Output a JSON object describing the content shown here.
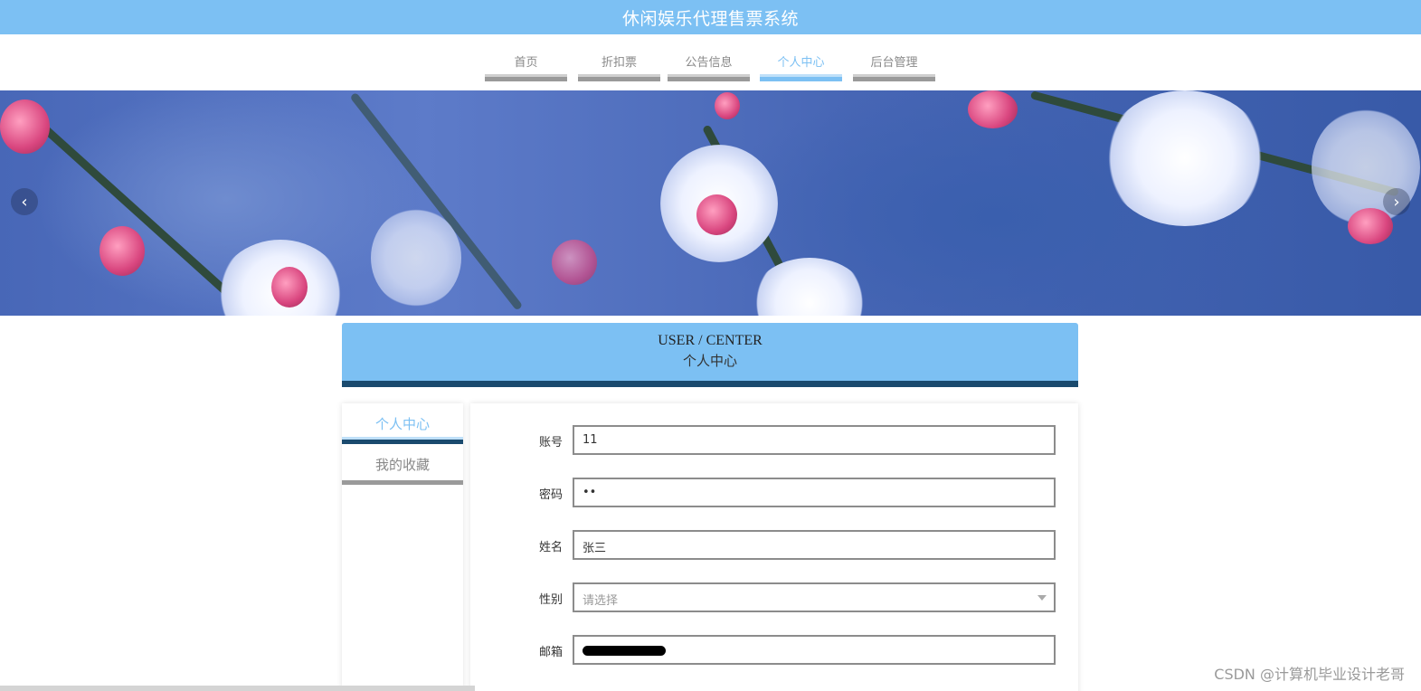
{
  "header": {
    "title": "休闲娱乐代理售票系统"
  },
  "nav": {
    "items": [
      {
        "label": "首页",
        "active": false
      },
      {
        "label": "折扣票",
        "active": false
      },
      {
        "label": "公告信息",
        "active": false
      },
      {
        "label": "个人中心",
        "active": true
      },
      {
        "label": "后台管理",
        "active": false
      }
    ]
  },
  "banner": {
    "prev_icon": "chevron-left-icon",
    "next_icon": "chevron-right-icon"
  },
  "section": {
    "title_en": "USER / CENTER",
    "title_cn": "个人中心"
  },
  "sidebar": {
    "items": [
      {
        "label": "个人中心",
        "active": true
      },
      {
        "label": "我的收藏",
        "active": false
      }
    ]
  },
  "form": {
    "account": {
      "label": "账号",
      "value": "11"
    },
    "password": {
      "label": "密码",
      "value": "••"
    },
    "name": {
      "label": "姓名",
      "value": "张三"
    },
    "gender": {
      "label": "性别",
      "placeholder": "请选择"
    },
    "email": {
      "label": "邮箱",
      "value": ""
    }
  },
  "watermark": "CSDN @计算机毕业设计老哥",
  "colors": {
    "accent": "#7cc0f3",
    "dark_accent": "#1a4a6e"
  }
}
